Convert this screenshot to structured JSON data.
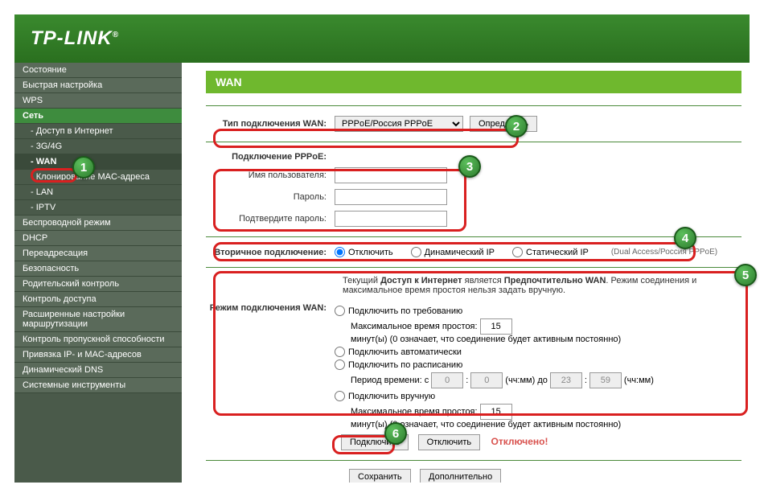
{
  "brand": "TP-LINK",
  "sidebar": {
    "items": [
      {
        "label": "Состояние"
      },
      {
        "label": "Быстрая настройка"
      },
      {
        "label": "WPS"
      },
      {
        "label": "Сеть",
        "section": true
      },
      {
        "label": "- Доступ в Интернет",
        "sub": true
      },
      {
        "label": "- 3G/4G",
        "sub": true
      },
      {
        "label": "- WAN",
        "sub": true,
        "active": true
      },
      {
        "label": "- Клонирование MAC-адреса",
        "sub": true
      },
      {
        "label": "- LAN",
        "sub": true
      },
      {
        "label": "- IPTV",
        "sub": true
      },
      {
        "label": "Беспроводной режим"
      },
      {
        "label": "DHCP"
      },
      {
        "label": "Переадресация"
      },
      {
        "label": "Безопасность"
      },
      {
        "label": "Родительский контроль"
      },
      {
        "label": "Контроль доступа"
      },
      {
        "label": "Расширенные настройки маршрутизации"
      },
      {
        "label": "Контроль пропускной способности"
      },
      {
        "label": "Привязка IP- и MAC-адресов"
      },
      {
        "label": "Динамический DNS"
      },
      {
        "label": "Системные инструменты"
      }
    ]
  },
  "page": {
    "title": "WAN",
    "conn_type_label": "Тип подключения WAN:",
    "conn_type_value": "PPPoE/Россия PPPoE",
    "detect_btn": "Определить",
    "pppoe_header": "Подключение PPPoE:",
    "username_label": "Имя пользователя:",
    "password_label": "Пароль:",
    "confirm_label": "Подтвердите пароль:",
    "secondary_label": "Вторичное подключение:",
    "sec_opts": {
      "disable": "Отключить",
      "dyn": "Динамический IP",
      "stat": "Статический IP",
      "hint": "(Dual Access/Россия PPPoE)"
    },
    "status_prefix": "Текущий",
    "status_b1": "Доступ к Интернет",
    "status_mid": "является",
    "status_b2": "Предпочтительно WAN",
    "status_suffix": ". Режим соединения и максимальное время простоя нельзя задать вручную.",
    "mode_label": "Режим подключения WAN:",
    "mode": {
      "demand": "Подключить по требованию",
      "auto": "Подключить автоматически",
      "schedule": "Подключить по расписанию",
      "manual": "Подключить вручную"
    },
    "idle_label": "Максимальное время простоя:",
    "idle_val1": "15",
    "idle_val2": "15",
    "idle_unit": "минут(ы) (0 означает, что соединение будет активным постоянно)",
    "period_label": "Период времени:  с",
    "period_from_h": "0",
    "period_from_m": "0",
    "period_mid": "(чч:мм) до",
    "period_to_h": "23",
    "period_to_m": "59",
    "period_end": "(чч:мм)",
    "connect_btn": "Подключить",
    "disconnect_btn": "Отключить",
    "disconnected": "Отключено!",
    "save_btn": "Сохранить",
    "advanced_btn": "Дополнительно"
  },
  "badges": [
    "1",
    "2",
    "3",
    "4",
    "5",
    "6"
  ]
}
